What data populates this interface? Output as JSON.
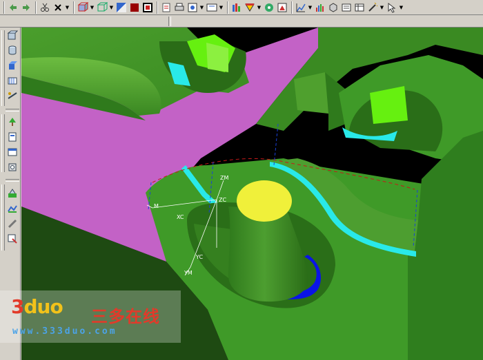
{
  "toolbar": {
    "icons": [
      "undo-icon",
      "redo-icon",
      "cut-icon",
      "close-icon",
      "view-orient-icon",
      "wireframe-icon",
      "shaded-icon",
      "color-icon",
      "layer-icon",
      "save-view-icon",
      "print-icon",
      "snap-icon",
      "selection-icon",
      "analysis-icon",
      "display-icon",
      "info-icon",
      "grid-icon",
      "chart-icon",
      "settings-icon",
      "filter-icon",
      "more-icon"
    ]
  },
  "viewport": {
    "axis_labels": {
      "zm": "ZM",
      "zc": "ZC",
      "xc": "XC",
      "yc": "YC",
      "ym": "YM",
      "xm": "M"
    },
    "colors": {
      "green": "#3f9a28",
      "green_dark": "#2a6e18",
      "green_light": "#66b83a",
      "magenta": "#c362c6",
      "bright_green": "#66f010",
      "cyan": "#29e9e9",
      "yellow": "#f0f03a",
      "blue": "#0a14e6"
    }
  },
  "watermark": {
    "brand_part1": "3",
    "brand_part2": "duo",
    "chinese": "三多在线",
    "url": "www.333duo.com"
  }
}
